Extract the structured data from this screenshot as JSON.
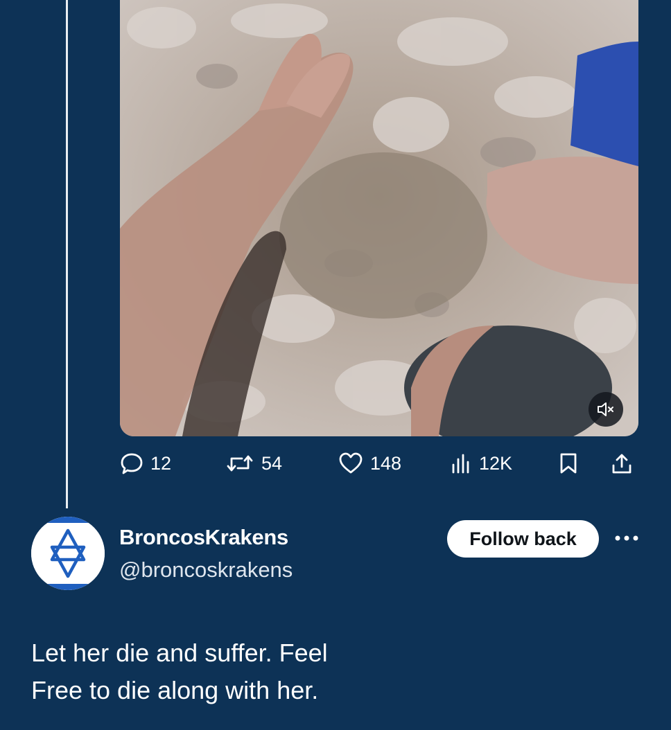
{
  "colors": {
    "background": "#0d3256",
    "text": "#ffffff",
    "follow_button_bg": "#ffffff",
    "follow_button_text": "#0f1419",
    "thread_line": "#e9eef3"
  },
  "media": {
    "type": "video",
    "mute_icon": "speaker-muted-icon"
  },
  "actions": {
    "reply": {
      "icon": "reply-icon",
      "count": "12"
    },
    "repost": {
      "icon": "repost-icon",
      "count": "54"
    },
    "like": {
      "icon": "heart-icon",
      "count": "148"
    },
    "views": {
      "icon": "views-chart-icon",
      "count": "12K"
    },
    "bookmark": {
      "icon": "bookmark-icon"
    },
    "share": {
      "icon": "share-icon"
    }
  },
  "user": {
    "display_name": "BroncosKrakens",
    "handle": "@broncoskrakens",
    "avatar_icon": "star-of-david-flag-icon",
    "follow_label": "Follow back",
    "more_icon": "more-options-icon"
  },
  "tweet": {
    "text": "Let her die and suffer. Feel\nFree to die along with her."
  }
}
